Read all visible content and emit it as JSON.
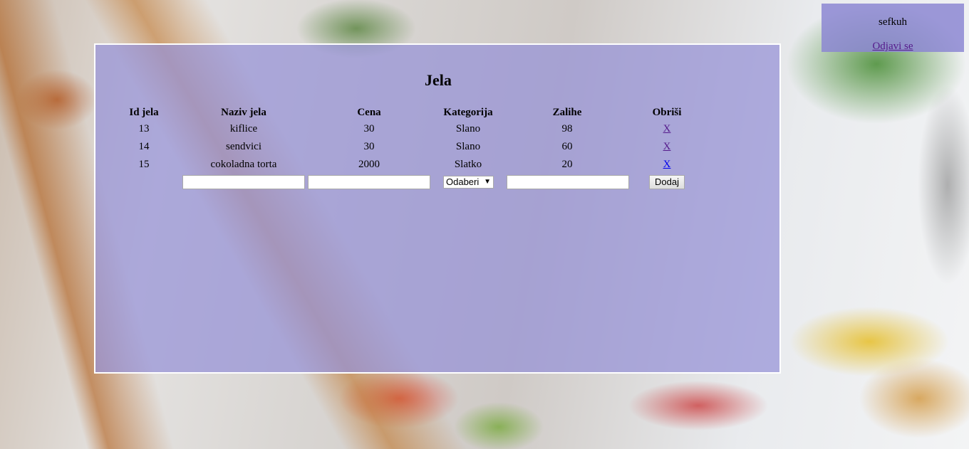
{
  "user": {
    "username": "sefkuh",
    "logout_label": "Odjavi se"
  },
  "panel": {
    "title": "Jela"
  },
  "table": {
    "headers": {
      "id": "Id jela",
      "name": "Naziv jela",
      "price": "Cena",
      "category": "Kategorija",
      "stock": "Zalihe",
      "delete": "Obriši"
    },
    "rows": [
      {
        "id": "13",
        "name": "kiflice",
        "price": "30",
        "category": "Slano",
        "stock": "98",
        "delete_label": "X"
      },
      {
        "id": "14",
        "name": "sendvici",
        "price": "30",
        "category": "Slano",
        "stock": "60",
        "delete_label": "X"
      },
      {
        "id": "15",
        "name": "cokoladna torta",
        "price": "2000",
        "category": "Slatko",
        "stock": "20",
        "delete_label": "X"
      }
    ]
  },
  "form": {
    "name_value": "",
    "price_value": "",
    "category_selected": "Odaberi",
    "stock_value": "",
    "add_label": "Dodaj"
  },
  "colors": {
    "panel_bg": "#968fd7",
    "link_visited": "#551a8b",
    "link": "#0000ee"
  }
}
